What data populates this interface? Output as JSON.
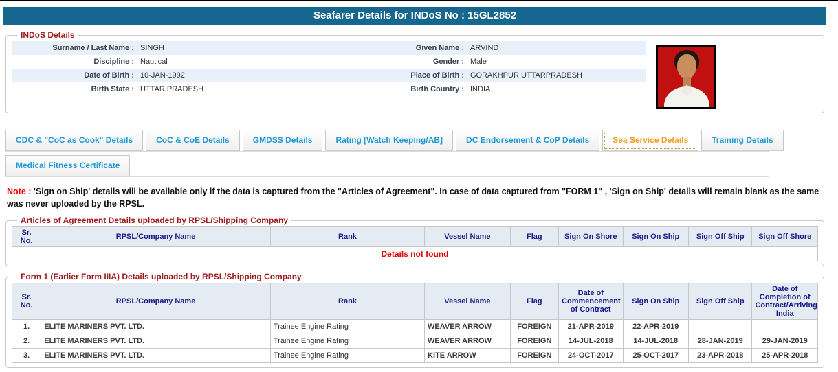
{
  "page": {
    "title": "Seafarer Details for INDoS No : 15GL2852"
  },
  "indos_details": {
    "legend": "INDoS Details",
    "rows": [
      {
        "label_left": "Surname / Last Name :",
        "value_left": "SINGH",
        "label_right": "Given Name :",
        "value_right": "ARVIND"
      },
      {
        "label_left": "Discipline :",
        "value_left": "Nautical",
        "label_right": "Gender :",
        "value_right": "Male"
      },
      {
        "label_left": "Date of Birth :",
        "value_left": "10-JAN-1992",
        "label_right": "Place of Birth :",
        "value_right": "GORAKHPUR UTTARPRADESH"
      },
      {
        "label_left": "Birth State :",
        "value_left": "UTTAR PRADESH",
        "label_right": "Birth Country :",
        "value_right": "INDIA"
      }
    ],
    "photo_alt": "seafarer-photo"
  },
  "tabs": {
    "row1": [
      {
        "label": "CDC & \"CoC as Cook\" Details",
        "active": false
      },
      {
        "label": "CoC & CoE Details",
        "active": false
      },
      {
        "label": "GMDSS Details",
        "active": false
      },
      {
        "label": "Rating [Watch Keeping/AB]",
        "active": false
      },
      {
        "label": "DC Endorsement & CoP Details",
        "active": false
      },
      {
        "label": "Sea Service Details",
        "active": true
      },
      {
        "label": "Training Details",
        "active": false
      }
    ],
    "row2": [
      {
        "label": "Medical Fitness Certificate",
        "active": false
      }
    ]
  },
  "note": {
    "prefix": "Note :",
    "text": " 'Sign on Ship' details will be available only if the data is captured from the \"Articles of Agreement\". In case of data captured from \"FORM 1\" , 'Sign on Ship' details will remain blank as the same was never uploaded by the RPSL."
  },
  "articles_table": {
    "legend": "Articles of Agreement Details uploaded by RPSL/Shipping Company",
    "headers": [
      "Sr. No.",
      "RPSL/Company Name",
      "Rank",
      "Vessel Name",
      "Flag",
      "Sign On Shore",
      "Sign On Ship",
      "Sign Off Ship",
      "Sign Off Shore"
    ],
    "empty_message": "Details not found"
  },
  "form1_table": {
    "legend": "Form 1 (Earlier Form IIIA) Details uploaded by RPSL/Shipping Company",
    "headers": [
      "Sr. No.",
      "RPSL/Company Name",
      "Rank",
      "Vessel Name",
      "Flag",
      "Date of Commencement of Contract",
      "Sign On Ship",
      "Sign Off Ship",
      "Date of Completion of Contract/Arriving India"
    ],
    "rows": [
      [
        "1.",
        "ELITE MARINERS PVT. LTD.",
        "Trainee Engine Rating",
        "WEAVER ARROW",
        "FOREIGN",
        "21-APR-2019",
        "22-APR-2019",
        "",
        ""
      ],
      [
        "2.",
        "ELITE MARINERS PVT. LTD.",
        "Trainee Engine Rating",
        "WEAVER ARROW",
        "FOREIGN",
        "14-JUL-2018",
        "14-JUL-2018",
        "28-JAN-2019",
        "29-JAN-2019"
      ],
      [
        "3.",
        "ELITE MARINERS PVT. LTD.",
        "Trainee Engine Rating",
        "KITE ARROW",
        "FOREIGN",
        "24-OCT-2017",
        "25-OCT-2017",
        "23-APR-2018",
        "25-APR-2018"
      ]
    ]
  },
  "colors": {
    "header_bar": "#15678F",
    "legend_red": "#9E1B1B",
    "tab_blue": "#1F9AD7",
    "active_tab_orange": "#F59C1F",
    "table_header_navy": "#1A1A8C",
    "row_stripe": "#E8F1FA",
    "error_red": "#E00000",
    "note_red": "#F00000",
    "photo_background": "#C01010"
  }
}
